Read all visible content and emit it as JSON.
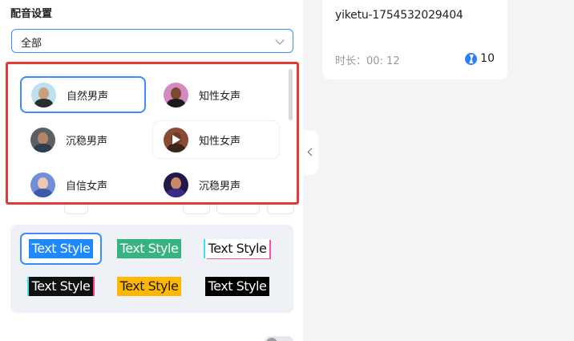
{
  "settings": {
    "section_title": "配音设置",
    "filter": {
      "value": "全部"
    }
  },
  "voices": [
    {
      "label": "自然男声",
      "state": "selected",
      "avatar": {
        "bg": "#bfe0f2",
        "skin": "#caa07c",
        "shirt": "#2d2d2d"
      }
    },
    {
      "label": "知性女声",
      "state": "normal",
      "avatar": {
        "bg": "#d38bbf",
        "skin": "#7a4a2e",
        "shirt": "#1c1c1c"
      }
    },
    {
      "label": "沉稳男声",
      "state": "normal",
      "avatar": {
        "bg": "#5b6066",
        "skin": "#b48566",
        "shirt": "#2c3e50"
      }
    },
    {
      "label": "知性女声",
      "state": "hover",
      "avatar": {
        "bg": "#8a4a34",
        "skin": "#6b3a22",
        "shirt": "#3b2418"
      }
    },
    {
      "label": "自信女声",
      "state": "normal",
      "avatar": {
        "bg": "#6f8fd8",
        "skin": "#f0c6b0",
        "shirt": "#3b5ba8"
      }
    },
    {
      "label": "沉稳男声",
      "state": "normal",
      "avatar": {
        "bg": "#1f1a4a",
        "skin": "#c98a63",
        "shirt": "#3a2a8a"
      }
    }
  ],
  "text_styles": [
    {
      "label": "Text Style",
      "variant": "blue"
    },
    {
      "label": "Text Style",
      "variant": "green"
    },
    {
      "label": "Text Style",
      "variant": "white-glitch"
    },
    {
      "label": "Text Style",
      "variant": "black-glitch"
    },
    {
      "label": "Text Style",
      "variant": "yellow"
    },
    {
      "label": "Text Style",
      "variant": "black"
    }
  ],
  "result": {
    "task_name": "yiketu-1754532029404",
    "duration": "时长：00: 12",
    "credits": "10"
  },
  "colors": {
    "accent": "#3d8bff",
    "highlight_frame": "#e53935"
  }
}
